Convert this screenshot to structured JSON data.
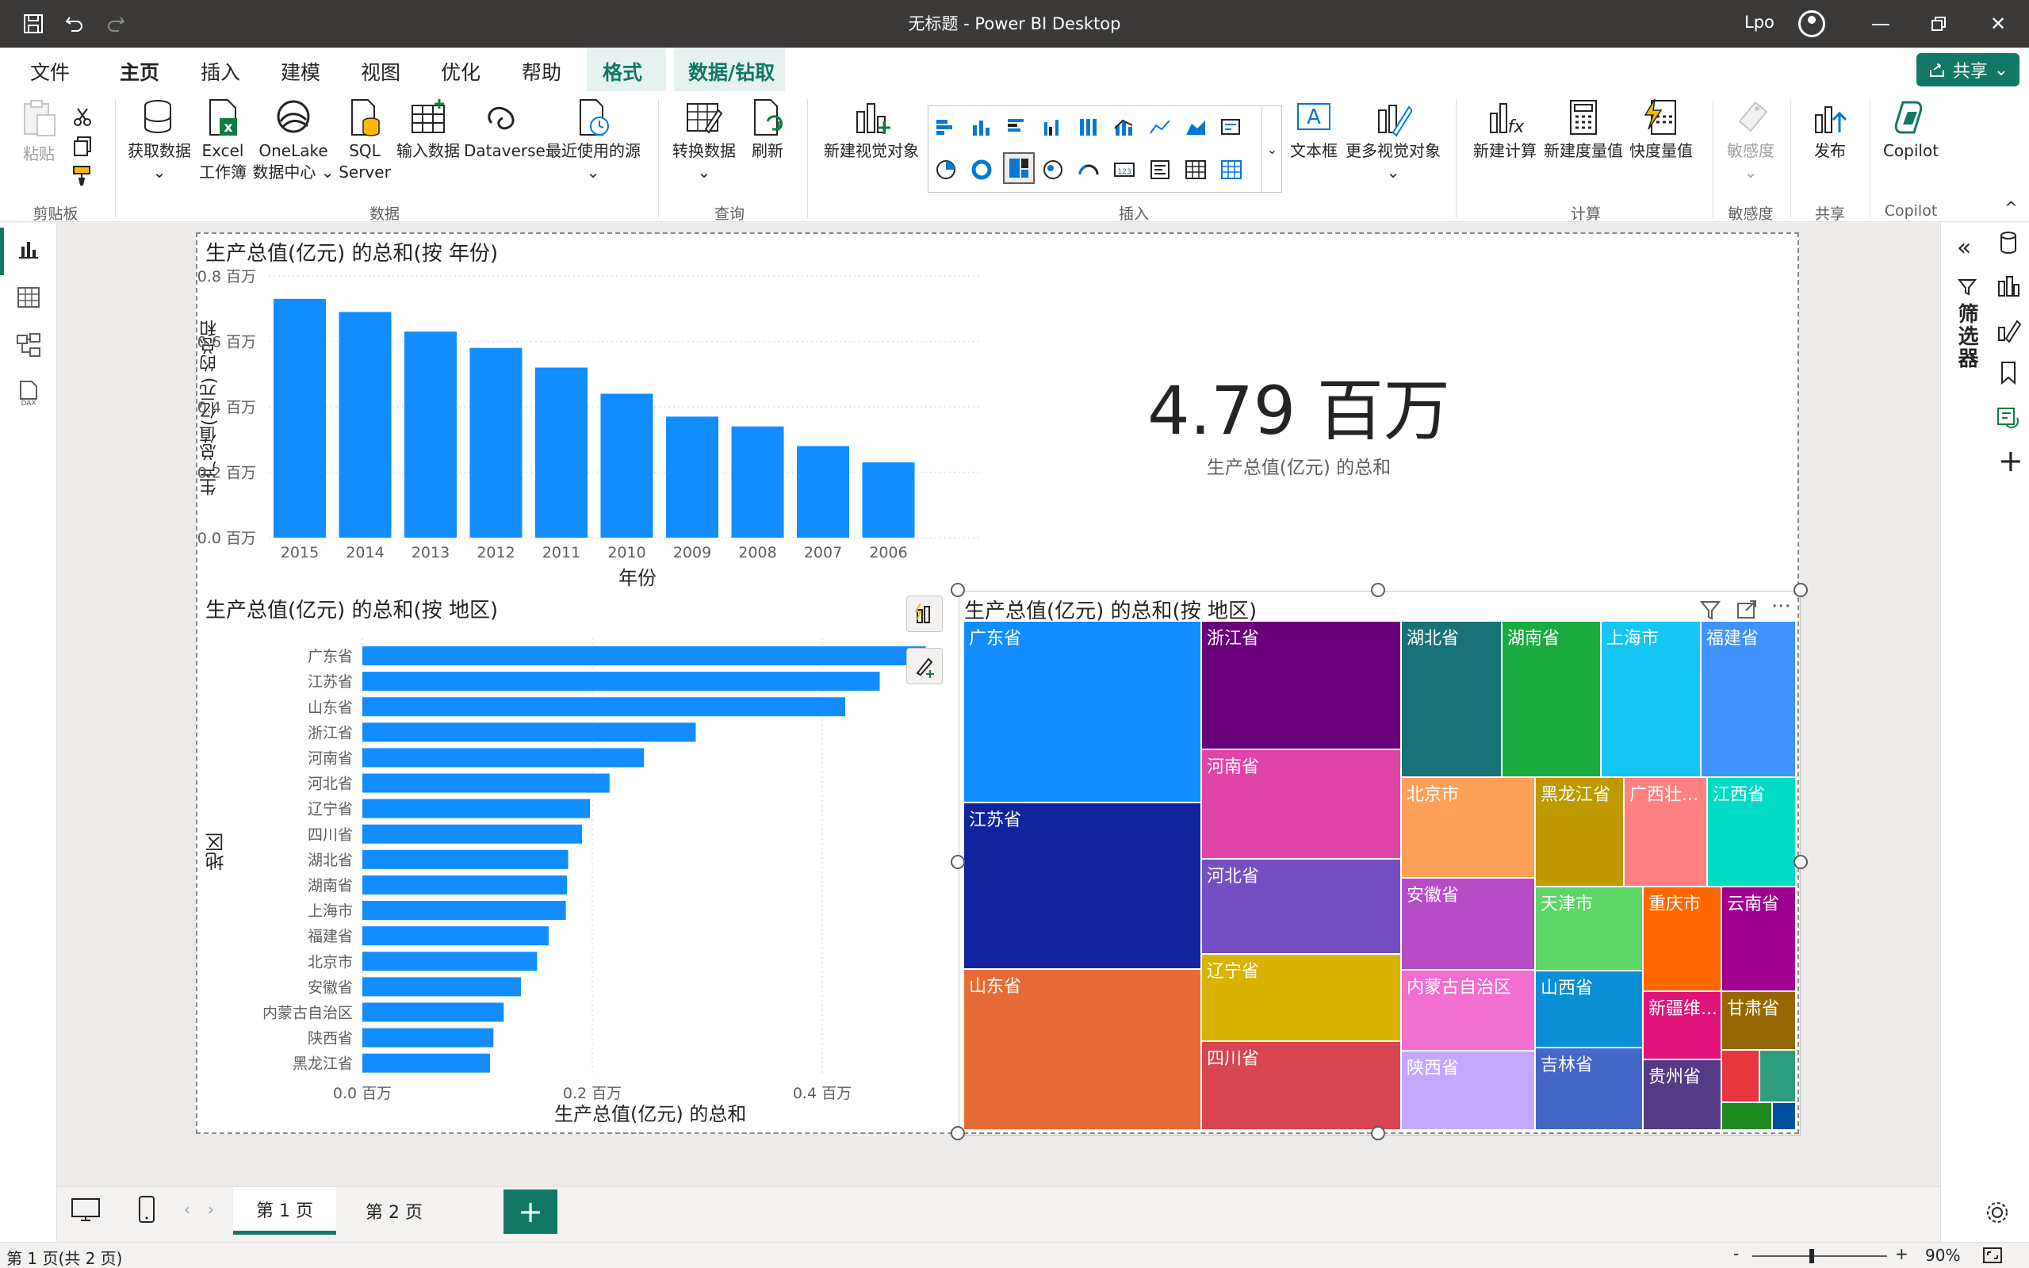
{
  "window": {
    "title": "无标题 - Power BI Desktop",
    "user": "Lpo"
  },
  "menu": {
    "tabs": [
      "文件",
      "主页",
      "插入",
      "建模",
      "视图",
      "优化",
      "帮助",
      "格式",
      "数据/钻取"
    ],
    "active": "主页",
    "share_label": "共享"
  },
  "ribbon": {
    "clipboard": {
      "paste": "粘贴",
      "group": "剪贴板"
    },
    "data": {
      "get_data": "获取数据",
      "excel_line1": "Excel",
      "excel_line2": "工作簿",
      "onelake_line1": "OneLake",
      "onelake_line2": "数据中心",
      "sql_line1": "SQL",
      "sql_line2": "Server",
      "enter_data": "输入数据",
      "dataverse": "Dataverse",
      "recent": "最近使用的源",
      "group": "数据"
    },
    "query": {
      "transform": "转换数据",
      "refresh": "刷新",
      "group": "查询"
    },
    "insert": {
      "new_visual": "新建视觉对象",
      "text_box": "文本框",
      "more_visuals": "更多视觉对象",
      "group": "插入"
    },
    "calc": {
      "new_calc": "新建计算",
      "new_measure": "新建度量值",
      "quick_measure": "快度量值",
      "group": "计算"
    },
    "sensitivity": {
      "label": "敏感度",
      "group": "敏感度"
    },
    "share": {
      "publish": "发布",
      "group": "共享"
    },
    "copilot": {
      "label": "Copilot",
      "group": "Copilot"
    }
  },
  "right_rail": {
    "filters_label": "筛选器"
  },
  "visuals": {
    "year_chart": {
      "title": "生产总值(亿元) 的总和(按 年份)",
      "ylabel": "生产总值(亿元) 的总和",
      "xlabel": "年份",
      "yticks": [
        "0.8 百万",
        "0.6 百万",
        "0.4 百万",
        "0.2 百万",
        "0.0 百万"
      ]
    },
    "card": {
      "value": "4.79 百万",
      "label": "生产总值(亿元) 的总和"
    },
    "region_bar": {
      "title": "生产总值(亿元) 的总和(按 地区)",
      "ylabel": "地区",
      "xlabel": "生产总值(亿元) 的总和",
      "xticks": [
        "0.0 百万",
        "0.2 百万",
        "0.4 百万"
      ]
    },
    "treemap": {
      "title": "生产总值(亿元) 的总和(按 地区)"
    }
  },
  "chart_data": [
    {
      "type": "bar",
      "title": "生产总值(亿元) 的总和(按 年份)",
      "xlabel": "年份",
      "ylabel": "生产总值(亿元) 的总和",
      "categories": [
        "2015",
        "2014",
        "2013",
        "2012",
        "2011",
        "2010",
        "2009",
        "2008",
        "2007",
        "2006"
      ],
      "values": [
        0.73,
        0.69,
        0.63,
        0.58,
        0.52,
        0.44,
        0.37,
        0.34,
        0.28,
        0.23
      ],
      "unit": "百万",
      "ylim": [
        0,
        0.8
      ],
      "color": "#118dff",
      "grid": true
    },
    {
      "type": "bar",
      "orientation": "horizontal",
      "title": "生产总值(亿元) 的总和(按 地区)",
      "xlabel": "生产总值(亿元) 的总和",
      "ylabel": "地区",
      "categories": [
        "广东省",
        "江苏省",
        "山东省",
        "浙江省",
        "河南省",
        "河北省",
        "辽宁省",
        "四川省",
        "湖北省",
        "湖南省",
        "上海市",
        "福建省",
        "北京市",
        "安徽省",
        "内蒙古自治区",
        "陕西省",
        "黑龙江省"
      ],
      "values": [
        0.49,
        0.45,
        0.42,
        0.29,
        0.245,
        0.215,
        0.198,
        0.191,
        0.179,
        0.178,
        0.177,
        0.162,
        0.152,
        0.138,
        0.123,
        0.114,
        0.111
      ],
      "unit": "百万",
      "xlim": [
        0,
        0.5
      ],
      "color": "#118dff",
      "grid": true
    },
    {
      "type": "treemap",
      "title": "生产总值(亿元) 的总和(按 地区)",
      "labels": [
        "广东省",
        "江苏省",
        "山东省",
        "浙江省",
        "河南省",
        "河北省",
        "辽宁省",
        "四川省",
        "湖北省",
        "湖南省",
        "上海市",
        "福建省",
        "北京市",
        "黑龙江省",
        "广西壮...",
        "江西省",
        "安徽省",
        "天津市",
        "重庆市",
        "云南省",
        "内蒙古自治区",
        "山西省",
        "新疆维...",
        "甘肃省",
        "陕西省",
        "吉林省",
        "贵州省"
      ],
      "colors": [
        "#118dff",
        "#12239e",
        "#e66c37",
        "#6b007b",
        "#e044a7",
        "#744ec2",
        "#d9b300",
        "#d64550",
        "#197278",
        "#1aab40",
        "#15c6f4",
        "#4092ff",
        "#ffa058",
        "#be9900",
        "#ff8080",
        "#00dcc3",
        "#b84bc6",
        "#5bd667",
        "#ff6600",
        "#9e0090",
        "#f26ecf",
        "#0a8fd6",
        "#e0127b",
        "#946800",
        "#c4a8ff",
        "#4468c8",
        "#553a85"
      ]
    }
  ],
  "page_tabs": [
    "第 1 页",
    "第 2 页"
  ],
  "status": {
    "page_info": "第 1 页(共 2 页)",
    "zoom": "90%"
  }
}
